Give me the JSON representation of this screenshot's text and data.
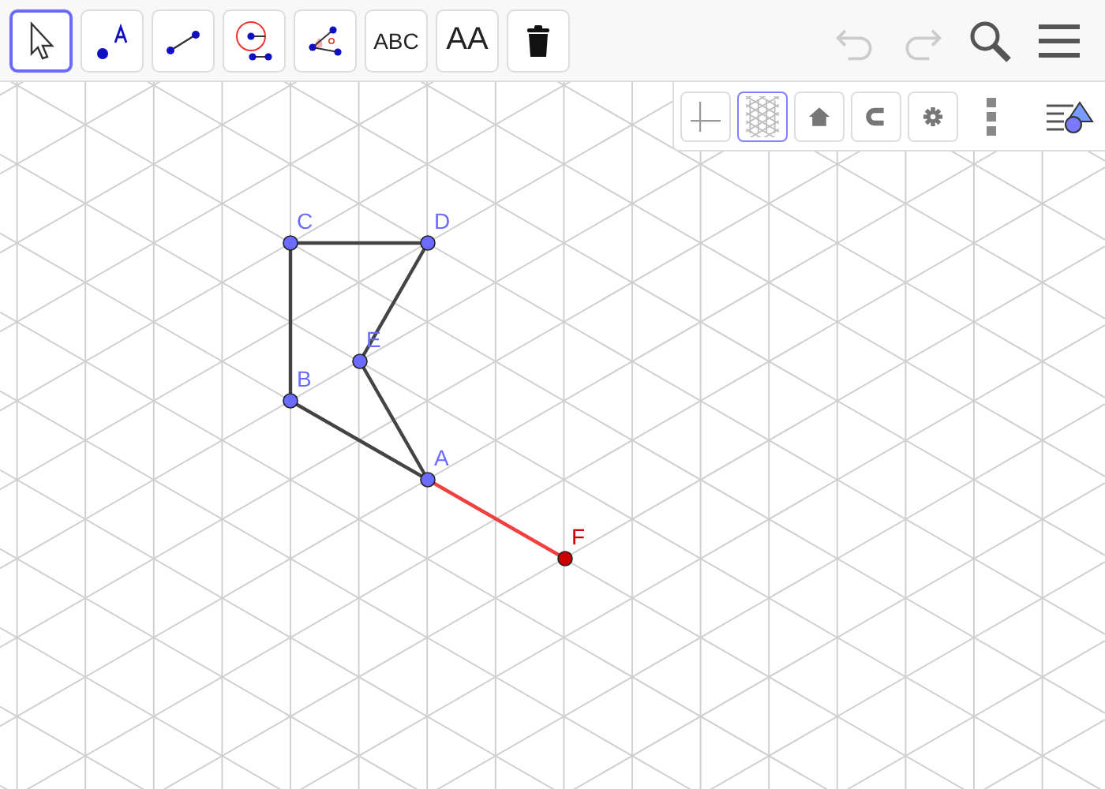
{
  "toolbar": {
    "tools": [
      {
        "kind": "move",
        "selected": true
      },
      {
        "kind": "point",
        "selected": false
      },
      {
        "kind": "segment",
        "selected": false
      },
      {
        "kind": "circle",
        "selected": false
      },
      {
        "kind": "angle",
        "selected": false
      },
      {
        "kind": "text",
        "label": "ABC",
        "selected": false
      },
      {
        "kind": "style",
        "label": "AA",
        "selected": false
      },
      {
        "kind": "delete",
        "selected": false
      }
    ],
    "undo": {
      "disabled": true
    },
    "redo": {
      "disabled": true
    }
  },
  "style_bar": {
    "buttons": [
      {
        "kind": "axes",
        "selected": false
      },
      {
        "kind": "grid",
        "selected": true
      },
      {
        "kind": "home",
        "selected": false
      },
      {
        "kind": "snap",
        "selected": false
      },
      {
        "kind": "settings",
        "selected": false
      }
    ]
  },
  "canvas": {
    "points": [
      {
        "label": "C",
        "color": "#6b6bff"
      },
      {
        "label": "D",
        "color": "#6b6bff"
      },
      {
        "label": "E",
        "color": "#6b6bff"
      },
      {
        "label": "B",
        "color": "#6b6bff"
      },
      {
        "label": "A",
        "color": "#6b6bff"
      },
      {
        "label": "F",
        "color": "#cc0000"
      }
    ]
  }
}
